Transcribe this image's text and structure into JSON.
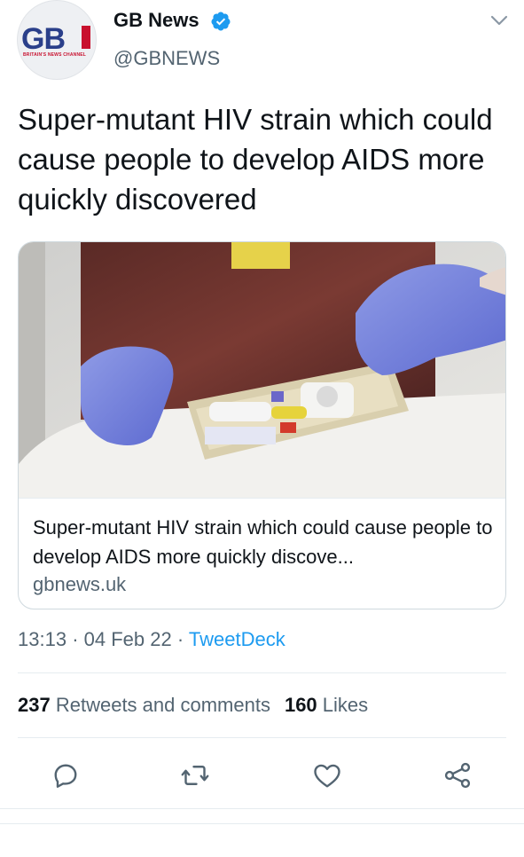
{
  "account": {
    "name": "GB News",
    "handle": "@GBNEWS",
    "logo_text": "GB",
    "logo_tagline": "BRITAIN'S NEWS CHANNEL",
    "verified_icon": "verified-badge-icon",
    "brand_color": "#2a3f8a",
    "verified_color": "#1d9bf0"
  },
  "tweet": {
    "text": "Super-mutant HIV strain which could cause people to develop AIDS more quickly discovered"
  },
  "card": {
    "image_icon": "photo-gloved-hands-test-kit",
    "title": "Super-mutant HIV strain which could cause people to develop AIDS more quickly discove...",
    "domain": "gbnews.uk"
  },
  "meta": {
    "time": "13:13",
    "separator": "·",
    "date": "04 Feb 22",
    "source": "TweetDeck"
  },
  "stats": {
    "retweets_count": "237",
    "retweets_label": "Retweets and comments",
    "likes_count": "160",
    "likes_label": "Likes"
  },
  "actions": {
    "reply_icon": "reply-icon",
    "retweet_icon": "retweet-icon",
    "like_icon": "heart-icon",
    "share_icon": "share-icon",
    "icon_color": "#536471"
  }
}
